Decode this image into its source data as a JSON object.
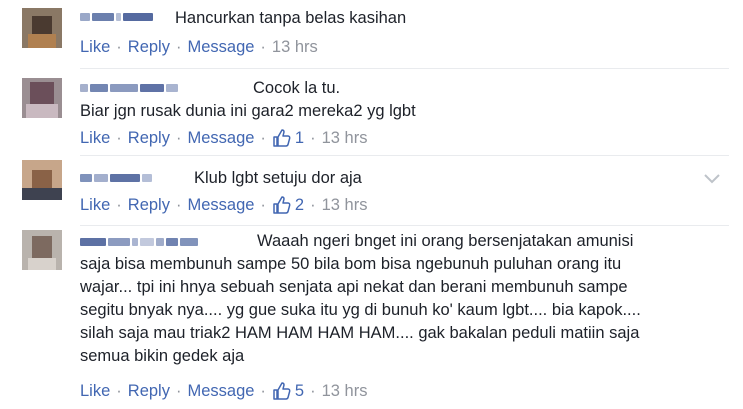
{
  "comments": [
    {
      "text": "Hancurkan tanpa belas kasihan",
      "actions": {
        "like": "Like",
        "reply": "Reply",
        "message": "Message",
        "time": "13 hrs",
        "likes": ""
      }
    },
    {
      "text": "Cocok la tu.\nBiar jgn rusak dunia ini gara2 mereka2 yg lgbt",
      "actions": {
        "like": "Like",
        "reply": "Reply",
        "message": "Message",
        "time": "13 hrs",
        "likes": "1"
      }
    },
    {
      "text": "Klub lgbt setuju dor aja",
      "actions": {
        "like": "Like",
        "reply": "Reply",
        "message": "Message",
        "time": "13 hrs",
        "likes": "2"
      }
    },
    {
      "text": "Waaah ngeri bnget ini orang bersenjatakan amunisi\nsaja bisa membunuh sampe 50 bila bom bisa ngebunuh puluhan orang itu\nwajar... tpi ini hnya sebuah senjata api nekat dan berani membunuh sampe\nsegitu bnyak nya.... yg gue suka itu yg di bunuh ko' kaum lgbt.... bia kapok....\nsilah saja mau triak2 HAM HAM HAM HAM.... gak bakalan peduli matiin saja\nsemua bikin gedek aja",
      "actions": {
        "like": "Like",
        "reply": "Reply",
        "message": "Message",
        "time": "13 hrs",
        "likes": "5"
      }
    }
  ],
  "colors": {
    "link": "#4267b2",
    "meta": "#90949c",
    "text": "#1d2129"
  },
  "icons": {
    "like": "thumbs-up-icon",
    "menu": "chevron-down-icon"
  }
}
